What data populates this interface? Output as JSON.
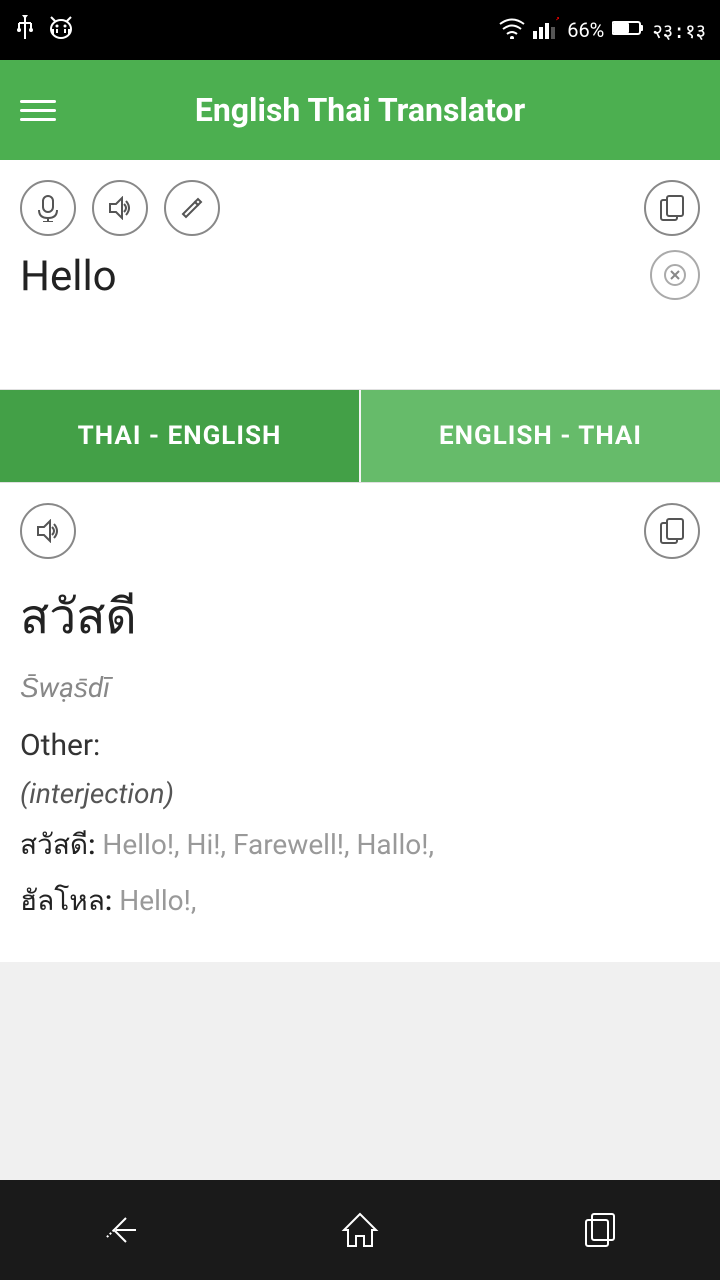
{
  "status_bar": {
    "left_icons": [
      "usb-icon",
      "android-icon"
    ],
    "wifi": "wifi",
    "signal": "signal",
    "battery": "66%",
    "time": "२३:१३"
  },
  "header": {
    "menu_label": "menu",
    "title": "English Thai Translator"
  },
  "input_area": {
    "mic_label": "mic",
    "speaker_label": "speaker",
    "edit_label": "edit",
    "copy_label": "copy",
    "input_text": "Hello",
    "clear_label": "clear"
  },
  "lang_toggle": {
    "btn1": "THAI - ENGLISH",
    "btn2": "ENGLISH - THAI"
  },
  "output_area": {
    "speaker_label": "speaker",
    "copy_label": "copy",
    "main_translation": "สวัสดี",
    "transliteration": "S̄wạs̄dī",
    "other_label": "Other:",
    "other_type": "(interjection)",
    "entries": [
      {
        "word": "สวัสดี:",
        "translations": " Hello!, Hi!, Farewell!, Hallo!,"
      },
      {
        "word": "ฮัลโหล:",
        "translations": " Hello!,"
      }
    ]
  },
  "nav_bar": {
    "back_label": "back",
    "home_label": "home",
    "recents_label": "recents"
  }
}
